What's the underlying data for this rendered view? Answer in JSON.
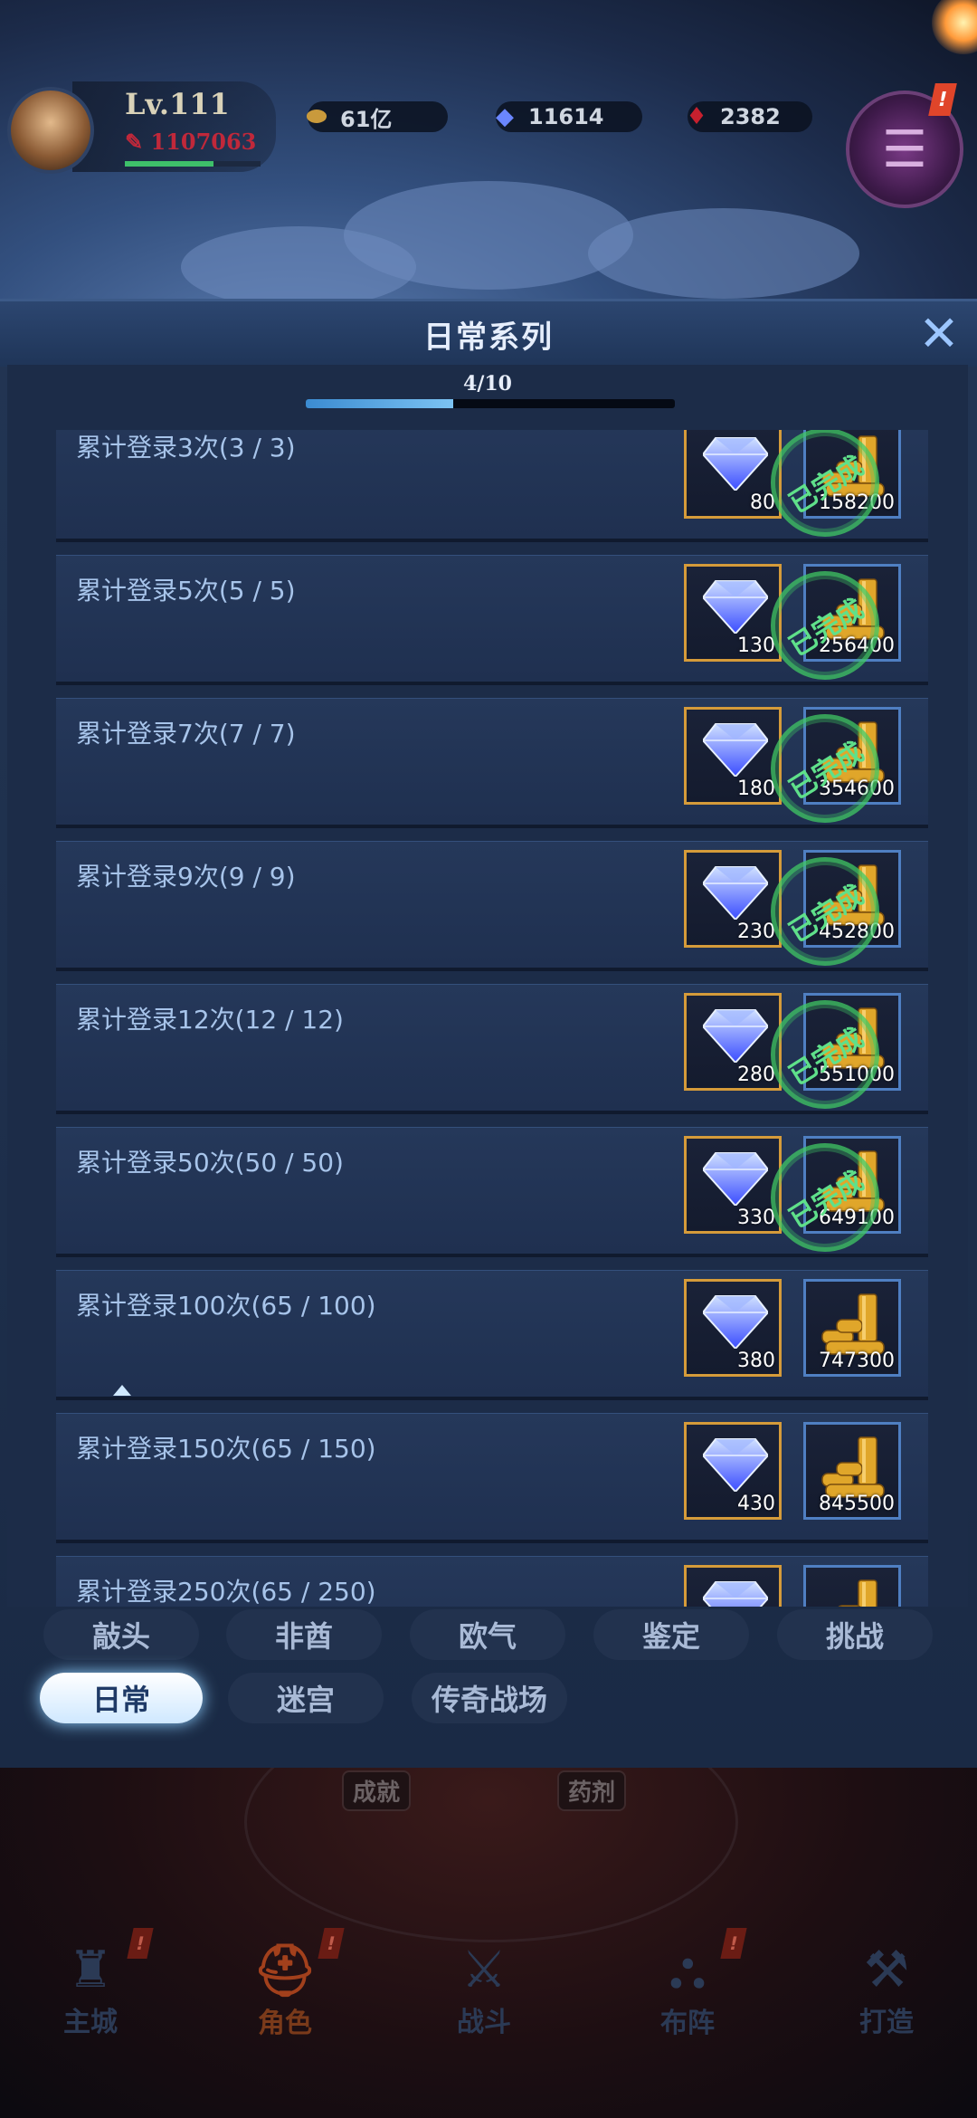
{
  "hud": {
    "level": "Lv.111",
    "power": "1107063",
    "resources": [
      {
        "icon": "gold-ingot-icon",
        "value": "61亿"
      },
      {
        "icon": "diamond-icon",
        "value": "11614"
      },
      {
        "icon": "red-crystal-icon",
        "value": "2382"
      }
    ],
    "quest_badge": "!"
  },
  "panel": {
    "title": "日常系列",
    "progress_text": "4/10",
    "progress": 0.4,
    "done_stamp": "已完成",
    "rows": [
      {
        "label": "累计登录3次(3 / 3)",
        "gem": "80",
        "gold": "158200",
        "done": true
      },
      {
        "label": "累计登录5次(5 / 5)",
        "gem": "130",
        "gold": "256400",
        "done": true
      },
      {
        "label": "累计登录7次(7 / 7)",
        "gem": "180",
        "gold": "354600",
        "done": true
      },
      {
        "label": "累计登录9次(9 / 9)",
        "gem": "230",
        "gold": "452800",
        "done": true
      },
      {
        "label": "累计登录12次(12 / 12)",
        "gem": "280",
        "gold": "551000",
        "done": true
      },
      {
        "label": "累计登录50次(50 / 50)",
        "gem": "330",
        "gold": "649100",
        "done": true
      },
      {
        "label": "累计登录100次(65 / 100)",
        "gem": "380",
        "gold": "747300",
        "done": false
      },
      {
        "label": "累计登录150次(65 / 150)",
        "gem": "430",
        "gold": "845500",
        "done": false
      },
      {
        "label": "累计登录250次(65 / 250)",
        "gem": "",
        "gold": "",
        "done": false
      }
    ]
  },
  "tabs": {
    "row1": [
      "敲头",
      "非酋",
      "欧气",
      "鉴定",
      "挑战"
    ],
    "row2": [
      "日常",
      "迷宫",
      "传奇战场"
    ],
    "active": "日常"
  },
  "background_labels": [
    "成就",
    "药剂"
  ],
  "bottom_nav": [
    {
      "label": "主城",
      "icon": "city-icon",
      "badge": "!"
    },
    {
      "label": "角色",
      "icon": "helmet-icon",
      "badge": "!"
    },
    {
      "label": "战斗",
      "icon": "crossed-swords-icon",
      "badge": ""
    },
    {
      "label": "布阵",
      "icon": "formation-icon",
      "badge": "!"
    },
    {
      "label": "打造",
      "icon": "anvil-icon",
      "badge": ""
    }
  ],
  "colors": {
    "accent": "#7cc3f2",
    "done_green": "#5fe08a",
    "gem_border": "#d59b3a",
    "gold_border": "#4f7fc2"
  }
}
